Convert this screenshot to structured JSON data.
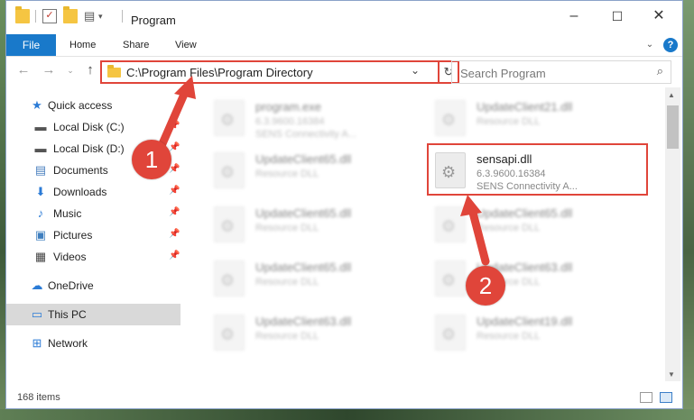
{
  "window": {
    "title": "Program",
    "controls": {
      "minimize": "–",
      "maximize": "☐",
      "close": "✕"
    }
  },
  "ribbon": {
    "tabs": [
      "File",
      "Home",
      "Share",
      "View"
    ],
    "help_icon": "?"
  },
  "address": {
    "path": "C:\\Program Files\\Program Directory",
    "search_placeholder": "Search Program"
  },
  "sidebar": {
    "items": [
      {
        "label": "Quick access",
        "icon": "star-icon"
      },
      {
        "label": "Local Disk (C:)",
        "icon": "drive-icon"
      },
      {
        "label": "Local Disk (D:)",
        "icon": "drive-icon"
      },
      {
        "label": "Documents",
        "icon": "documents-icon"
      },
      {
        "label": "Downloads",
        "icon": "downloads-icon"
      },
      {
        "label": "Music",
        "icon": "music-icon"
      },
      {
        "label": "Pictures",
        "icon": "pictures-icon"
      },
      {
        "label": "Videos",
        "icon": "videos-icon"
      },
      {
        "label": "OneDrive",
        "icon": "cloud-icon"
      },
      {
        "label": "This PC",
        "icon": "computer-icon",
        "selected": true
      },
      {
        "label": "Network",
        "icon": "network-icon"
      }
    ]
  },
  "files": [
    {
      "name": "program.exe",
      "line2": "6.3.9600.16384",
      "line3": "SENS Connectivity A..."
    },
    {
      "name": "UpdateClient21.dll",
      "line2": "Resource DLL"
    },
    {
      "name": "UpdateClient65.dll",
      "line2": "Resource DLL"
    },
    {
      "name": "sensapi.dll",
      "line2": "6.3.9600.16384",
      "line3": "SENS Connectivity A..."
    },
    {
      "name": "UpdateClient65.dll",
      "line2": "Resource DLL"
    },
    {
      "name": "UpdateClient65.dll",
      "line2": "Resource DLL"
    },
    {
      "name": "UpdateClient65.dll",
      "line2": "Resource DLL"
    },
    {
      "name": "UpdateClient63.dll",
      "line2": "Resource DLL"
    },
    {
      "name": "UpdateClient63.dll",
      "line2": "Resource DLL"
    },
    {
      "name": "UpdateClient19.dll",
      "line2": "Resource DLL"
    }
  ],
  "status": {
    "item_count": "168 items"
  },
  "callouts": [
    "1",
    "2"
  ],
  "colors": {
    "accent": "#1979ca",
    "annotation": "#e0453a"
  }
}
